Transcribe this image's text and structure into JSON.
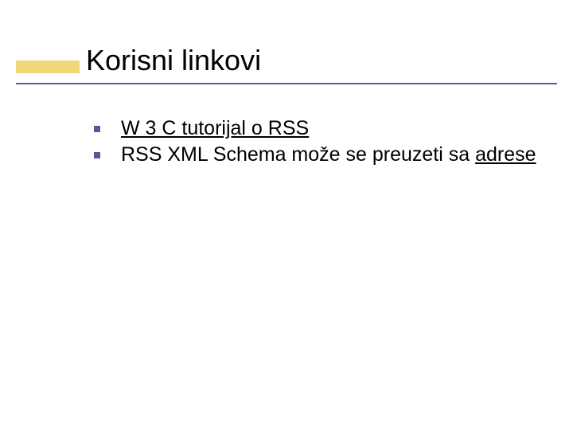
{
  "slide": {
    "title": "Korisni linkovi",
    "bullets": [
      {
        "link_prefix": "",
        "link_text": "W 3 C tutorijal o RSS",
        "link_suffix": ""
      },
      {
        "link_prefix": "RSS XML Schema može se preuzeti sa ",
        "link_text": "adrese",
        "link_suffix": ""
      }
    ]
  }
}
